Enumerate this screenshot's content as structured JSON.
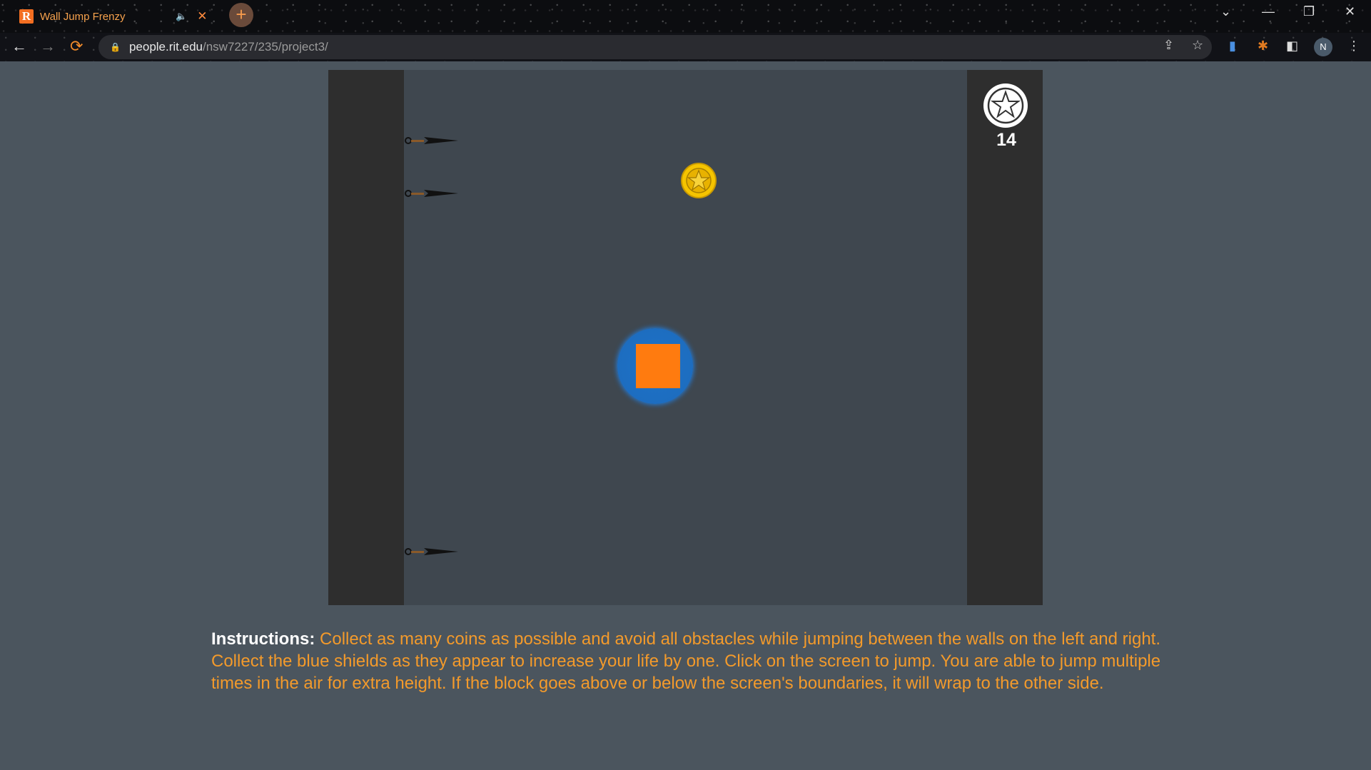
{
  "browser": {
    "tab": {
      "title": "Wall Jump Frenzy",
      "favicon_letter": "R"
    },
    "new_tab_label": "+",
    "url_host": "people.rit.edu",
    "url_path": "/nsw7227/235/project3/",
    "avatar_initial": "N"
  },
  "game": {
    "score": "14",
    "accent_colors": {
      "player": "#ff7b0f",
      "shield": "#1e73c7",
      "coin": "#f5c400"
    }
  },
  "instructions": {
    "label": "Instructions:",
    "text": " Collect as many coins as possible and avoid all obstacles while jumping between the walls on the left and right. Collect the blue shields as they appear to increase your life by one. Click on the screen to jump. You are able to jump multiple times in the air for extra height. If the block goes above or below the screen's boundaries, it will wrap to the other side."
  }
}
